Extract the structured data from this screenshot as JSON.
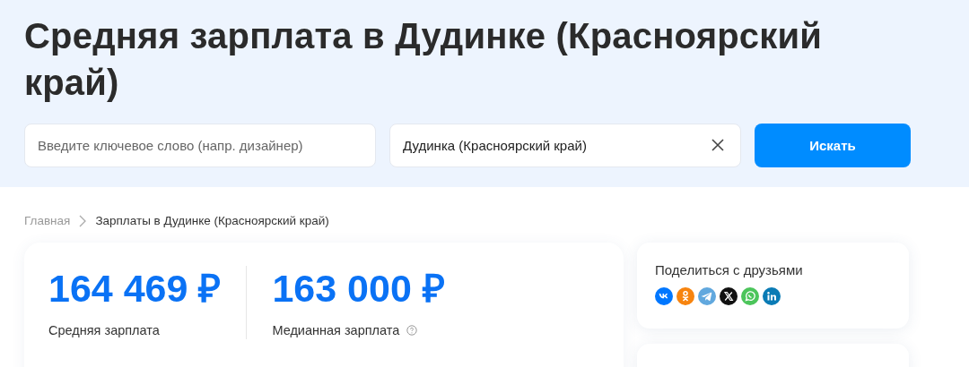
{
  "title": "Средняя зарплата в Дудинке (Красноярский край)",
  "search": {
    "keyword": {
      "placeholder": "Введите ключевое слово (напр. дизайнер)"
    },
    "location": {
      "value": "Дудинка (Красноярский край)"
    },
    "button": "Искать"
  },
  "breadcrumbs": [
    {
      "label": "Главная",
      "current": false
    },
    {
      "label": "Зарплаты в Дудинке (Красноярский край)",
      "current": true
    }
  ],
  "stats": [
    {
      "value": "164 469 ₽",
      "label": "Средняя зарплата",
      "help": false
    },
    {
      "value": "163 000 ₽",
      "label": "Медианная зарплата",
      "help": true
    }
  ],
  "share": {
    "title": "Поделиться с друзьями",
    "networks": [
      {
        "kind": "vk"
      },
      {
        "kind": "ok"
      },
      {
        "kind": "telegram"
      },
      {
        "kind": "x"
      },
      {
        "kind": "whatsapp"
      },
      {
        "kind": "linkedin"
      }
    ]
  }
}
